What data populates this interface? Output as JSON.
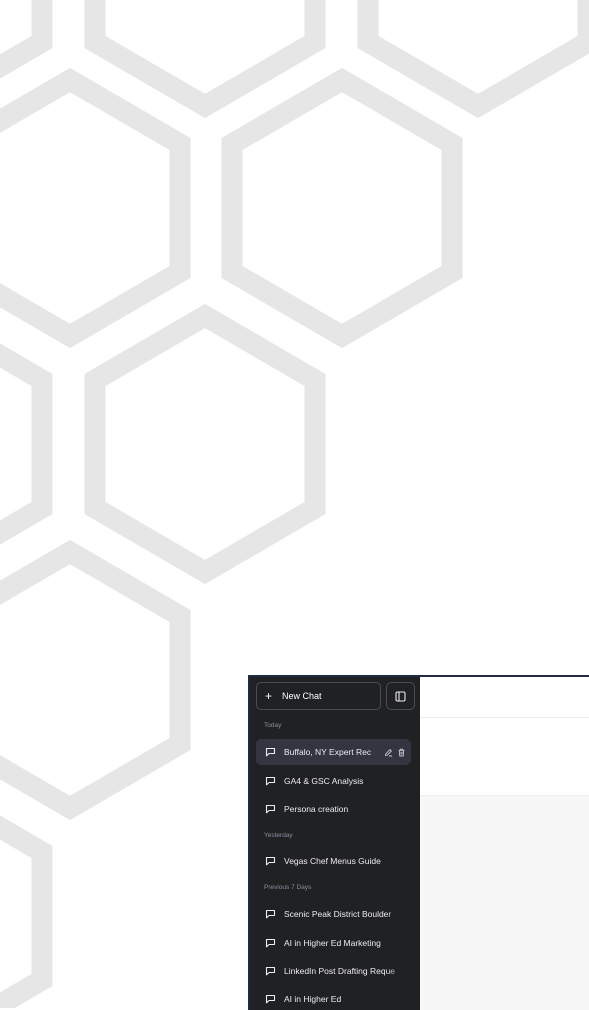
{
  "sidebar": {
    "new_chat_label": "New Chat",
    "sections": [
      {
        "label": "Today",
        "items": [
          {
            "label": "Buffalo, NY Expert Rec",
            "active": true
          },
          {
            "label": "GA4 & GSC Analysis"
          },
          {
            "label": "Persona creation"
          }
        ]
      },
      {
        "label": "Yesterday",
        "items": [
          {
            "label": "Vegas Chef Menus Guide"
          }
        ]
      },
      {
        "label": "Previous 7 Days",
        "items": [
          {
            "label": "Scenic Peak District Boulder"
          },
          {
            "label": "AI in Higher Ed Marketing"
          },
          {
            "label": "LinkedIn Post Drafting Reque"
          },
          {
            "label": "AI in Higher Ed"
          }
        ]
      }
    ],
    "icons": {
      "plus": "plus-icon",
      "toggle": "sidebar-toggle-icon",
      "chat": "message-icon",
      "edit": "pencil-icon",
      "delete": "trash-icon"
    }
  },
  "colors": {
    "sidebar_bg": "#202123",
    "active_item_bg": "#343541",
    "hex_pattern": "#e6e6e6",
    "window_border": "#1f2a44"
  }
}
